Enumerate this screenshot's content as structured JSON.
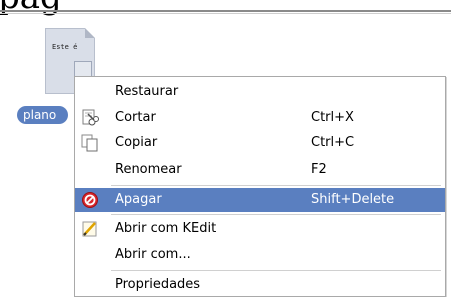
{
  "header": {
    "partial_text": "pag"
  },
  "file": {
    "preview_text": "Este é",
    "label": "plano"
  },
  "menu": {
    "items": [
      {
        "label": "Restaurar",
        "shortcut": "",
        "icon": ""
      },
      {
        "label": "Cortar",
        "shortcut": "Ctrl+X",
        "icon": "scissors-icon"
      },
      {
        "label": "Copiar",
        "shortcut": "Ctrl+C",
        "icon": "copy-icon"
      },
      {
        "label": "Renomear",
        "shortcut": "F2",
        "icon": ""
      },
      {
        "label": "Apagar",
        "shortcut": "Shift+Delete",
        "icon": "delete-icon"
      },
      {
        "label": "Abrir com KEdit",
        "shortcut": "",
        "icon": "kedit-icon"
      },
      {
        "label": "Abrir com...",
        "shortcut": "",
        "icon": ""
      },
      {
        "label": "Propriedades",
        "shortcut": "",
        "icon": ""
      }
    ]
  },
  "colors": {
    "highlight": "#5a7fc0",
    "highlight_text": "#ffffff"
  }
}
